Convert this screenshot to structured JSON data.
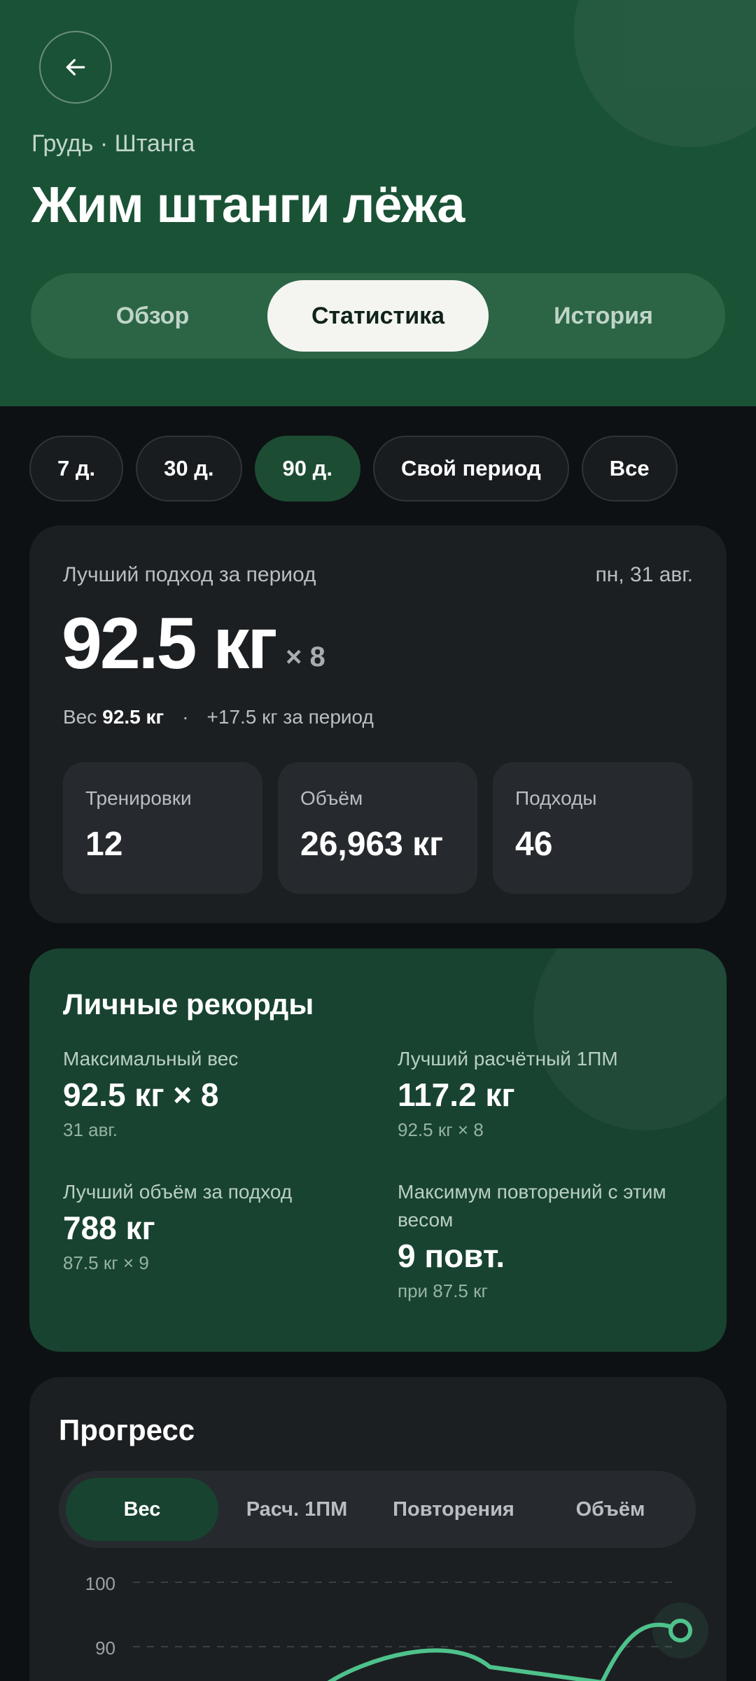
{
  "header": {
    "subtitle": "Грудь · Штанга",
    "title": "Жим штанги лёжа",
    "tabs": [
      {
        "label": "Обзор"
      },
      {
        "label": "Статистика"
      },
      {
        "label": "История"
      }
    ],
    "active_tab": "Статистика"
  },
  "periods": {
    "items": [
      {
        "label": "7 д."
      },
      {
        "label": "30 д."
      },
      {
        "label": "90 д."
      },
      {
        "label": "Свой период"
      },
      {
        "label": "Все"
      }
    ],
    "active": "90 д."
  },
  "best_set": {
    "label": "Лучший подход за период",
    "date": "пн, 31 авг.",
    "value": "92.5 кг",
    "reps": "× 8",
    "weight_label": "Вес",
    "weight_value": "92.5 кг",
    "separator": "·",
    "change": "+17.5 кг за период",
    "stats": [
      {
        "label": "Тренировки",
        "value": "12"
      },
      {
        "label": "Объём",
        "value": "26,963 кг"
      },
      {
        "label": "Подходы",
        "value": "46"
      }
    ]
  },
  "records": {
    "title": "Личные рекорды",
    "items": [
      {
        "label": "Максимальный вес",
        "value": "92.5 кг × 8",
        "sub": "31 авг."
      },
      {
        "label": "Лучший расчётный 1ПМ",
        "value": "117.2 кг",
        "sub": "92.5 кг × 8"
      },
      {
        "label": "Лучший объём за подход",
        "value": "788 кг",
        "sub": "87.5 кг × 9"
      },
      {
        "label": "Максимум повторений с этим весом",
        "value": "9 повт.",
        "sub": "при 87.5 кг"
      }
    ]
  },
  "progress": {
    "title": "Прогресс",
    "tabs": [
      {
        "label": "Вес"
      },
      {
        "label": "Расч. 1ПМ"
      },
      {
        "label": "Повторения"
      },
      {
        "label": "Объём"
      }
    ],
    "active_tab": "Вес"
  },
  "chart_data": {
    "type": "line",
    "y_ticks": [
      "100",
      "90"
    ],
    "grid": true,
    "series": [
      {
        "values": [
          87.5,
          90,
          92.5
        ]
      }
    ]
  },
  "colors": {
    "header_bg": "#1a5236",
    "accent": "#4fc28c",
    "card_bg": "#1c1f22",
    "page_bg": "#0d1114"
  },
  "icons": {
    "back": "arrow-left-icon"
  }
}
